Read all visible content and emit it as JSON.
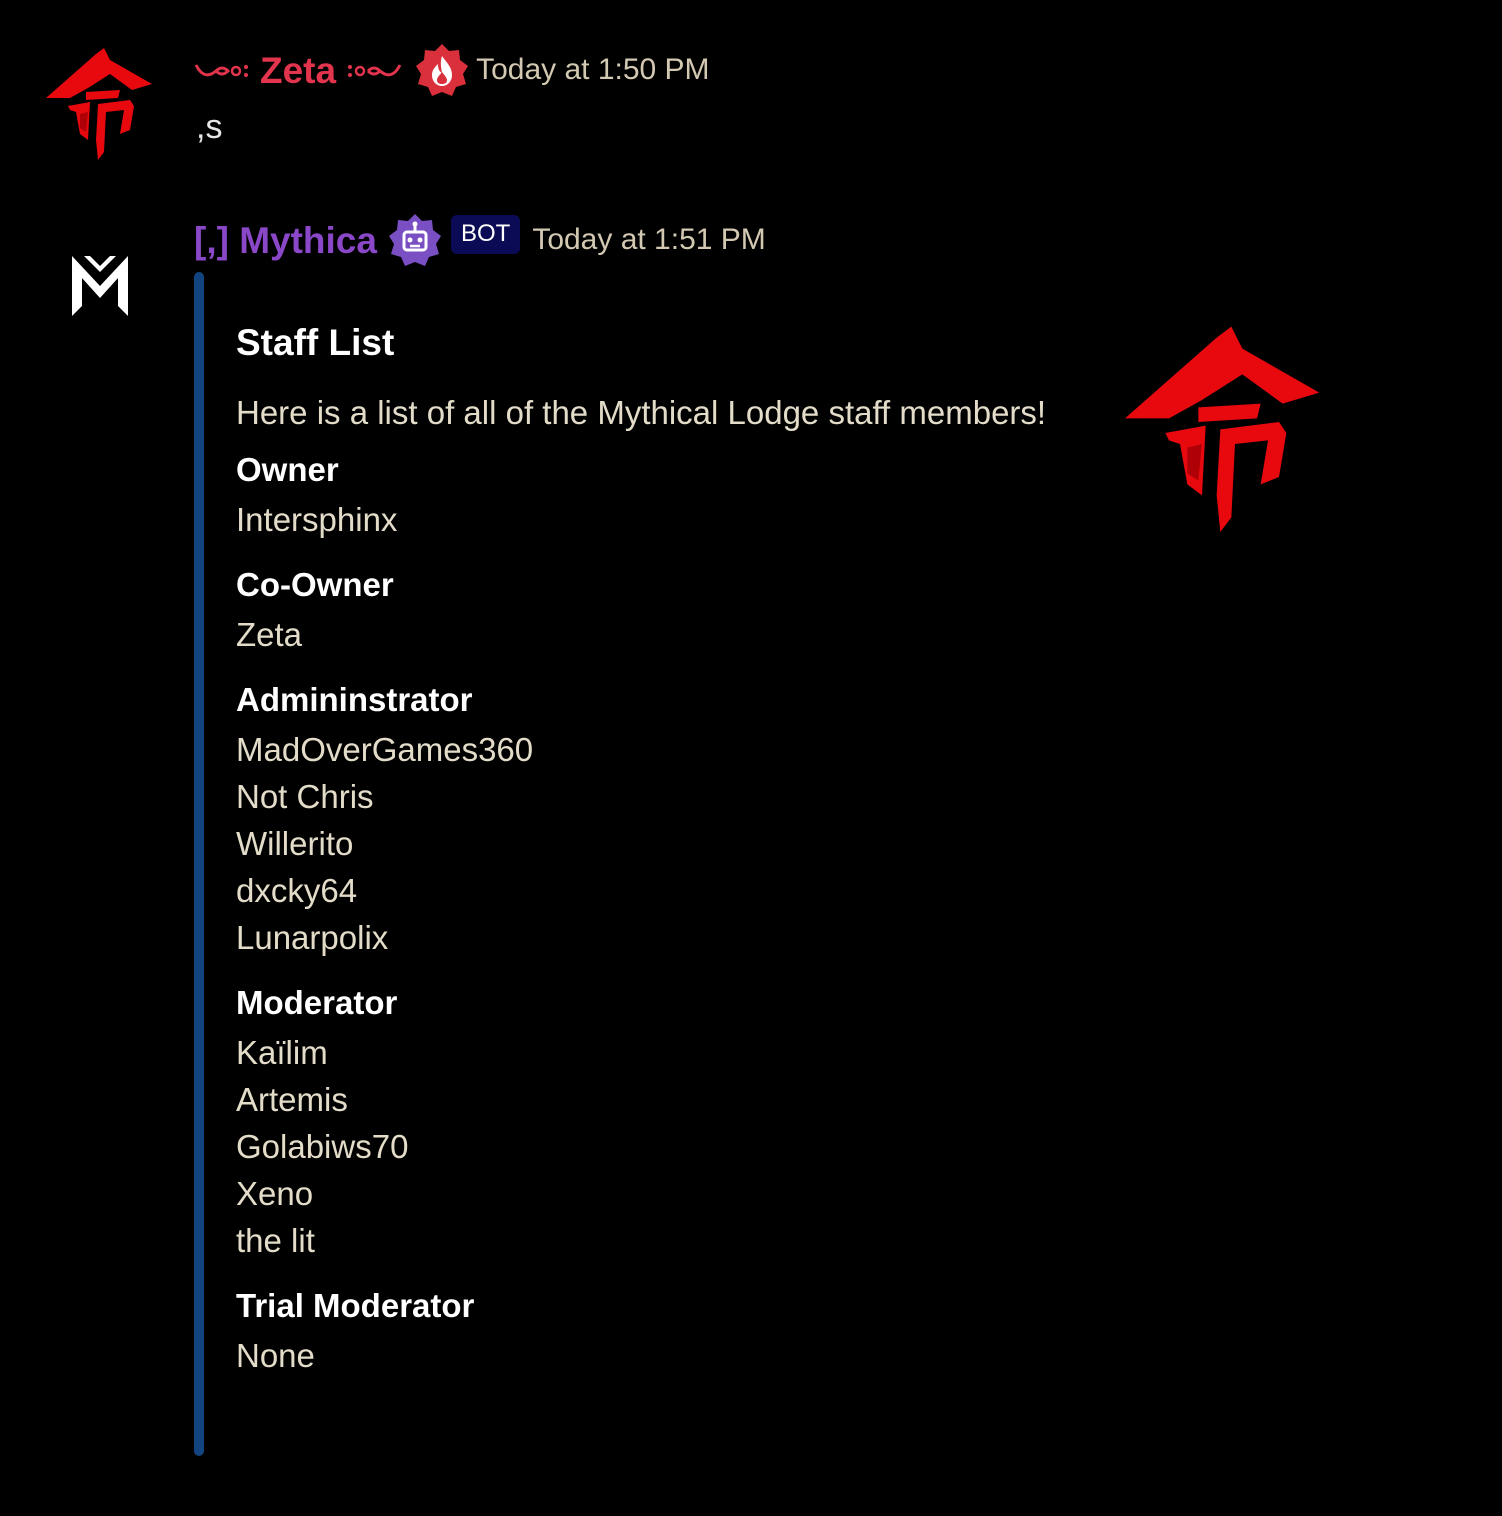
{
  "messages": [
    {
      "author": "Zeta",
      "timestamp": "Today at 1:50 PM",
      "content": ",s",
      "avatar_icon": "red-kanji-icon",
      "role_icon": "fire-badge-icon",
      "name_color": "#e3344d"
    },
    {
      "author": "[,] Mythica",
      "timestamp": "Today at 1:51 PM",
      "bot_tag": "BOT",
      "avatar_icon": "mythica-m-logo-icon",
      "role_icon": "robot-badge-icon",
      "name_color": "#8a47c7",
      "embed": {
        "title": "Staff List",
        "description": "Here is a list of all of the Mythical Lodge staff members!",
        "accent_color": "#12457f",
        "thumbnail_icon": "red-kanji-icon",
        "fields": [
          {
            "name": "Owner",
            "values": [
              "Intersphinx"
            ]
          },
          {
            "name": "Co-Owner",
            "values": [
              "Zeta"
            ]
          },
          {
            "name": "Admininstrator",
            "values": [
              "MadOverGames360",
              "Not Chris",
              "Willerito",
              "dxcky64",
              "Lunarpolix"
            ]
          },
          {
            "name": "Moderator",
            "values": [
              "Kaïlim",
              "Artemis",
              "Golabiws70",
              "Xeno",
              "the lit"
            ]
          },
          {
            "name": "Trial Moderator",
            "values": [
              "None"
            ]
          }
        ]
      }
    }
  ]
}
